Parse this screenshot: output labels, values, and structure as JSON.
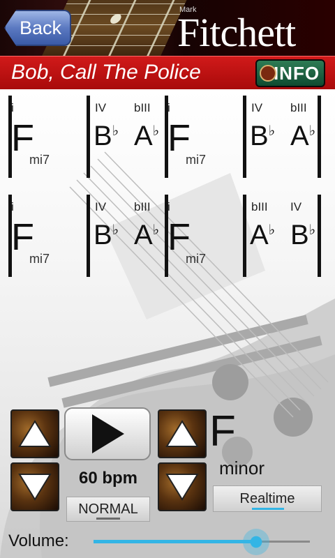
{
  "header": {
    "back_label": "Back",
    "brand_first": "Mark",
    "brand_last": "Fitchett"
  },
  "song": {
    "title": "Bob, Call The Police",
    "info_label": "INFO"
  },
  "chart": {
    "rows": [
      [
        {
          "romans": [
            "i"
          ],
          "chords": [
            {
              "root": "F",
              "acc": "",
              "qual": "mi7"
            }
          ]
        },
        {
          "romans": [
            "IV",
            "bIII"
          ],
          "chords": [
            {
              "root": "B",
              "acc": "♭",
              "qual": ""
            },
            {
              "root": "A",
              "acc": "♭",
              "qual": ""
            }
          ]
        },
        {
          "romans": [
            "i"
          ],
          "chords": [
            {
              "root": "F",
              "acc": "",
              "qual": "mi7"
            }
          ]
        },
        {
          "romans": [
            "IV",
            "bIII"
          ],
          "chords": [
            {
              "root": "B",
              "acc": "♭",
              "qual": ""
            },
            {
              "root": "A",
              "acc": "♭",
              "qual": ""
            }
          ]
        }
      ],
      [
        {
          "romans": [
            "i"
          ],
          "chords": [
            {
              "root": "F",
              "acc": "",
              "qual": "mi7"
            }
          ]
        },
        {
          "romans": [
            "IV",
            "bIII"
          ],
          "chords": [
            {
              "root": "B",
              "acc": "♭",
              "qual": ""
            },
            {
              "root": "A",
              "acc": "♭",
              "qual": ""
            }
          ]
        },
        {
          "romans": [
            "i"
          ],
          "chords": [
            {
              "root": "F",
              "acc": "",
              "qual": "mi7"
            }
          ]
        },
        {
          "romans": [
            "bIII",
            "IV"
          ],
          "chords": [
            {
              "root": "A",
              "acc": "♭",
              "qual": ""
            },
            {
              "root": "B",
              "acc": "♭",
              "qual": ""
            }
          ]
        }
      ]
    ]
  },
  "controls": {
    "tempo": "60 bpm",
    "speed_mode": "NORMAL",
    "key": "F",
    "mode": "minor",
    "playback_mode": "Realtime",
    "volume_label": "Volume:",
    "volume_level": 0.75
  },
  "colors": {
    "accent": "#33b5e5",
    "title_bar": "#c01010"
  }
}
